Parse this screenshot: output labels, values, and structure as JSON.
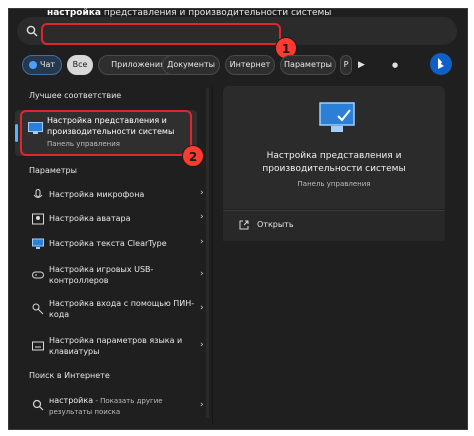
{
  "search": {
    "typed": "настройка",
    "completion": " представления и производительности системы"
  },
  "filters": {
    "chat": "Чат",
    "all": "Все",
    "apps": "Приложения",
    "docs": "Документы",
    "web": "Интернет",
    "settings": "Параметры",
    "more": "Р",
    "more_arrow": "▶",
    "more_dots": "●"
  },
  "best_match": {
    "header": "Лучшее соответствие",
    "title": "Настройка представления и производительности системы",
    "subtitle": "Панель управления"
  },
  "settings_section": {
    "header": "Параметры",
    "items": [
      {
        "label": "Настройка микрофона",
        "icon": "microphone-icon"
      },
      {
        "label": "Настройка аватара",
        "icon": "avatar-icon"
      },
      {
        "label": "Настройка текста ClearType",
        "icon": "monitor-icon"
      },
      {
        "label": "Настройка игровых USB-контроллеров",
        "icon": "gamepad-icon"
      },
      {
        "label": "Настройка входа с помощью ПИН-кода",
        "icon": "key-icon"
      },
      {
        "label": "Настройка параметров языка и клавиатуры",
        "icon": "keyboard-icon"
      }
    ]
  },
  "web_section": {
    "header": "Поиск в Интернете",
    "query": "настройка",
    "hint": " - Показать другие результаты поиска"
  },
  "preview": {
    "title": "Настройка представления и производительности системы",
    "subtitle": "Панель управления",
    "open_label": "Открыть"
  },
  "annotations": {
    "first": "1",
    "second": "2"
  },
  "colors": {
    "highlight": "#e0262c",
    "badge": "#ff3b2f",
    "accent": "#5ab2ff"
  }
}
